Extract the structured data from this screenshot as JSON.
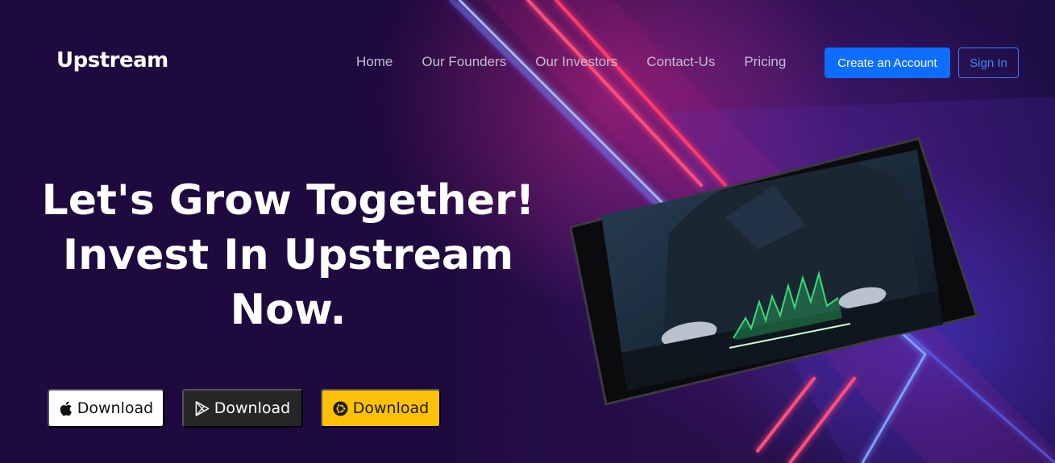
{
  "brand": {
    "name": "Upstream"
  },
  "nav": {
    "links": [
      "Home",
      "Our Founders",
      "Our Investors",
      "Contact-Us",
      "Pricing"
    ],
    "create_account": "Create an Account",
    "sign_in": "Sign In"
  },
  "hero": {
    "headline_lines": [
      "Let's Grow Together!",
      "Invest In Upstream",
      "Now."
    ]
  },
  "downloads": [
    {
      "label": "Download",
      "icon": "apple-icon"
    },
    {
      "label": "Download",
      "icon": "google-play-icon"
    },
    {
      "label": "Download",
      "icon": "ubuntu-icon"
    }
  ],
  "colors": {
    "background": "#1e0a3f",
    "primary": "#0d6efd",
    "warning": "#ffc107",
    "dark": "#262626"
  }
}
